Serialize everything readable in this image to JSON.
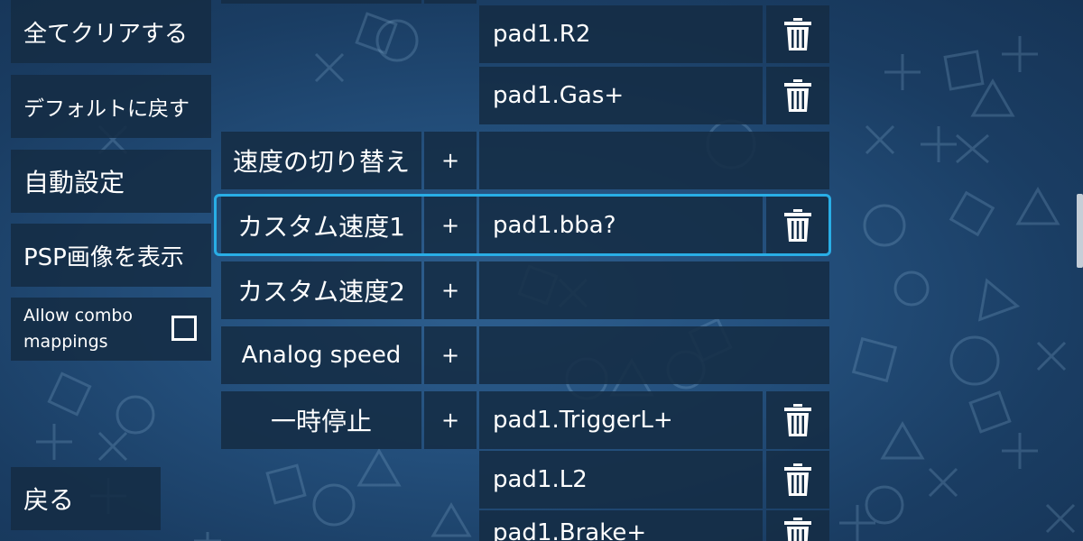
{
  "sidebar": {
    "clear_all": "全てクリアする",
    "reset_default": "デフォルトに戻す",
    "auto_config": "自動設定",
    "show_psp_image": "PSP画像を表示",
    "allow_combo": "Allow combo mappings",
    "allow_combo_checked": false,
    "back": "戻る"
  },
  "mapping": {
    "add_label": "+",
    "rows": {
      "speed_toggle": {
        "label": "速度の切り替え"
      },
      "custom_speed_1": {
        "label": "カスタム速度1",
        "binding": "pad1.bba?"
      },
      "custom_speed_2": {
        "label": "カスタム速度2"
      },
      "analog_speed": {
        "label": "Analog speed"
      },
      "pause": {
        "label": "一時停止",
        "bindings": [
          "pad1.TriggerL+",
          "pad1.L2",
          "pad1.Brake+"
        ]
      }
    },
    "previous_bindings": [
      "pad1.R2",
      "pad1.Gas+"
    ]
  },
  "theme": {
    "accent": "#29aee6",
    "tile": "#142c44",
    "background": "#24507d"
  }
}
